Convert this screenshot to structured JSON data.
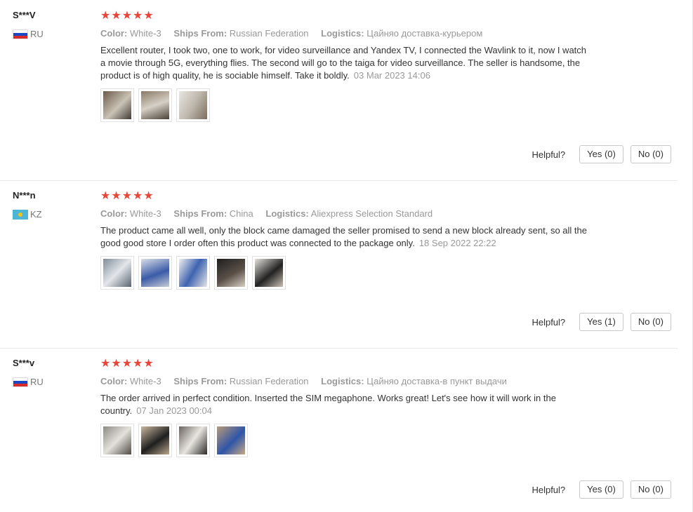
{
  "reviews": [
    {
      "user": "S***V",
      "country": "RU",
      "stars": "★★★★★",
      "color_label": "Color:",
      "color": "White-3",
      "ships_label": "Ships From:",
      "ships": "Russian Federation",
      "logistics_label": "Logistics:",
      "logistics": "Цайняо доставка-курьером",
      "text": "Excellent router, I took two, one to work, for video surveillance and Yandex TV, I connected the Wavlink to it, now I watch a movie through 5G, everything flies. The second will go to the taiga for video surveillance. The seller is handsome, the product is of high quality, he is sociable himself. Take it boldly.",
      "date": "03 Mar 2023 14:06",
      "photos": 3,
      "helpful_label": "Helpful?",
      "yes": "Yes (0)",
      "no": "No (0)"
    },
    {
      "user": "N***n",
      "country": "KZ",
      "stars": "★★★★★",
      "color_label": "Color:",
      "color": "White-3",
      "ships_label": "Ships From:",
      "ships": "China",
      "logistics_label": "Logistics:",
      "logistics": "Aliexpress Selection Standard",
      "text": "The product came all well, only the block came damaged the seller promised to send a new block already sent, so all the good good store I order often this product was connected to the package only.",
      "date": "18 Sep 2022 22:22",
      "photos": 5,
      "helpful_label": "Helpful?",
      "yes": "Yes (1)",
      "no": "No (0)"
    },
    {
      "user": "S***v",
      "country": "RU",
      "stars": "★★★★★",
      "color_label": "Color:",
      "color": "White-3",
      "ships_label": "Ships From:",
      "ships": "Russian Federation",
      "logistics_label": "Logistics:",
      "logistics": "Цайняо доставка-в пункт выдачи",
      "text": "The order arrived in perfect condition. Inserted the SIM megaphone. Works great! Let's see how it will work in the country.",
      "date": "07 Jan 2023 00:04",
      "photos": 4,
      "helpful_label": "Helpful?",
      "yes": "Yes (0)",
      "no": "No (0)"
    }
  ]
}
